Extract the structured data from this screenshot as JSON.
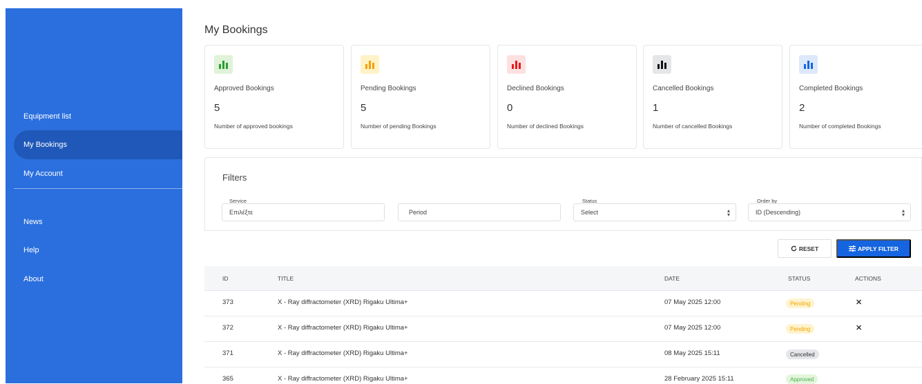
{
  "sidebar": {
    "items": [
      {
        "label": "Equipment list"
      },
      {
        "label": "My Bookings"
      },
      {
        "label": "My Account"
      },
      {
        "label": "News"
      },
      {
        "label": "Help"
      },
      {
        "label": "About"
      }
    ],
    "active_index": 1
  },
  "page": {
    "title": "My Bookings"
  },
  "cards": [
    {
      "label": "Approved Bookings",
      "value": "5",
      "desc": "Number of approved bookings",
      "icon": "bar-chart-icon",
      "color": "#2e9d32",
      "bg": "#dff3d8"
    },
    {
      "label": "Pending Bookings",
      "value": "5",
      "desc": "Number of pending Bookings",
      "icon": "bar-chart-icon",
      "color": "#f5a000",
      "bg": "#fff2c7"
    },
    {
      "label": "Declined Bookings",
      "value": "0",
      "desc": "Number of declined Bookings",
      "icon": "bar-chart-icon",
      "color": "#e81919",
      "bg": "#fde0e0"
    },
    {
      "label": "Cancelled Bookings",
      "value": "1",
      "desc": "Number of cancelled Bookings",
      "icon": "bar-chart-icon",
      "color": "#111111",
      "bg": "#e5e6e8"
    },
    {
      "label": "Completed Bookings",
      "value": "2",
      "desc": "Number of completed Bookings",
      "icon": "bar-chart-icon",
      "color": "#1565e0",
      "bg": "#dde8fb"
    }
  ],
  "filters": {
    "title": "Filters",
    "service": {
      "label": "Service",
      "placeholder": "Επιλέξτε"
    },
    "period": {
      "placeholder": "Period"
    },
    "status": {
      "label": "Status",
      "value": "Select"
    },
    "order": {
      "label": "Order by",
      "value": "ID (Descending)"
    },
    "reset_label": "RESET",
    "apply_label": "APPLY FILTER"
  },
  "table": {
    "headers": {
      "id": "ID",
      "title": "TITLE",
      "date": "DATE",
      "status": "STATUS",
      "actions": "ACTIONS"
    },
    "rows": [
      {
        "id": "373",
        "title": "X - Ray diffractometer (XRD) Rigaku Ultima+",
        "date": "07 May 2025 12:00",
        "status": "Pending",
        "status_kind": "pending",
        "action": "✕"
      },
      {
        "id": "372",
        "title": "X - Ray diffractometer (XRD) Rigaku Ultima+",
        "date": "07 May 2025 12:00",
        "status": "Pending",
        "status_kind": "pending",
        "action": "✕"
      },
      {
        "id": "371",
        "title": "X - Ray diffractometer (XRD) Rigaku Ultima+",
        "date": "08 May 2025 15:11",
        "status": "Cancelled",
        "status_kind": "cancelled",
        "action": ""
      },
      {
        "id": "365",
        "title": "X - Ray diffractometer (XRD) Rigaku Ultima+",
        "date": "28 February 2025 15:11",
        "status": "Approved",
        "status_kind": "approved",
        "action": ""
      }
    ]
  },
  "colors": {
    "sidebar": "#2b6fde",
    "sidebar_active": "#1f58b8",
    "primary_button": "#1565e0"
  }
}
